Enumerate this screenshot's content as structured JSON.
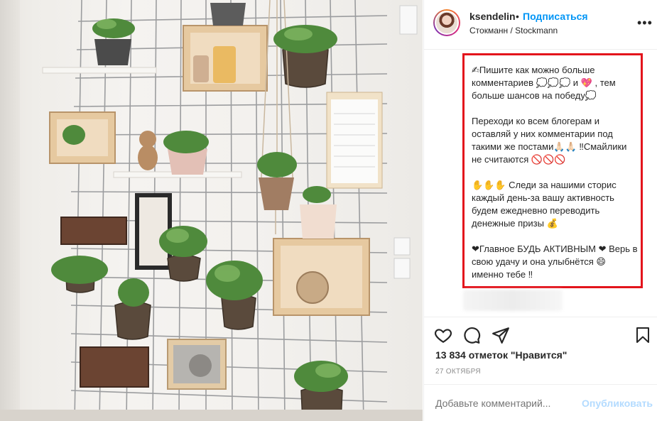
{
  "post": {
    "username": "ksendelin",
    "separator": "•",
    "follow_label": "Подписаться",
    "location": "Стокманн / Stockmann",
    "more_label": "•••"
  },
  "caption": {
    "p1": "✍Пишите как можно больше комментариев 💭💭💭 и 💖 , тем больше шансов на победу💭",
    "p2": "Переходи ко всем блогерам и оставляй у них комментарии под такими же постами🙏🏻🙏🏻 ‼Смайлики не считаются 🚫🚫🚫",
    "p3": "✋✋✋ Следи за нашими сторис каждый день-за вашу активность будем ежедневно переводить денежные призы 💰",
    "p4": "❤Главное БУДЬ АКТИВНЫМ ❤ Верь в свою удачу и она улыбнётся 😄 именно тебе ‼"
  },
  "stats": {
    "likes": "13 834 отметок \"Нравится\"",
    "date": "27 ОКТЯБРЯ"
  },
  "comment": {
    "placeholder": "Добавьте комментарий...",
    "publish_label": "Опубликовать"
  },
  "icons": {
    "like": "heart-icon",
    "comment": "comment-icon",
    "share": "share-icon",
    "save": "bookmark-icon"
  },
  "colors": {
    "accent": "#0095f6",
    "highlight_border": "#e3141c",
    "publish_disabled": "#b3dbff"
  }
}
